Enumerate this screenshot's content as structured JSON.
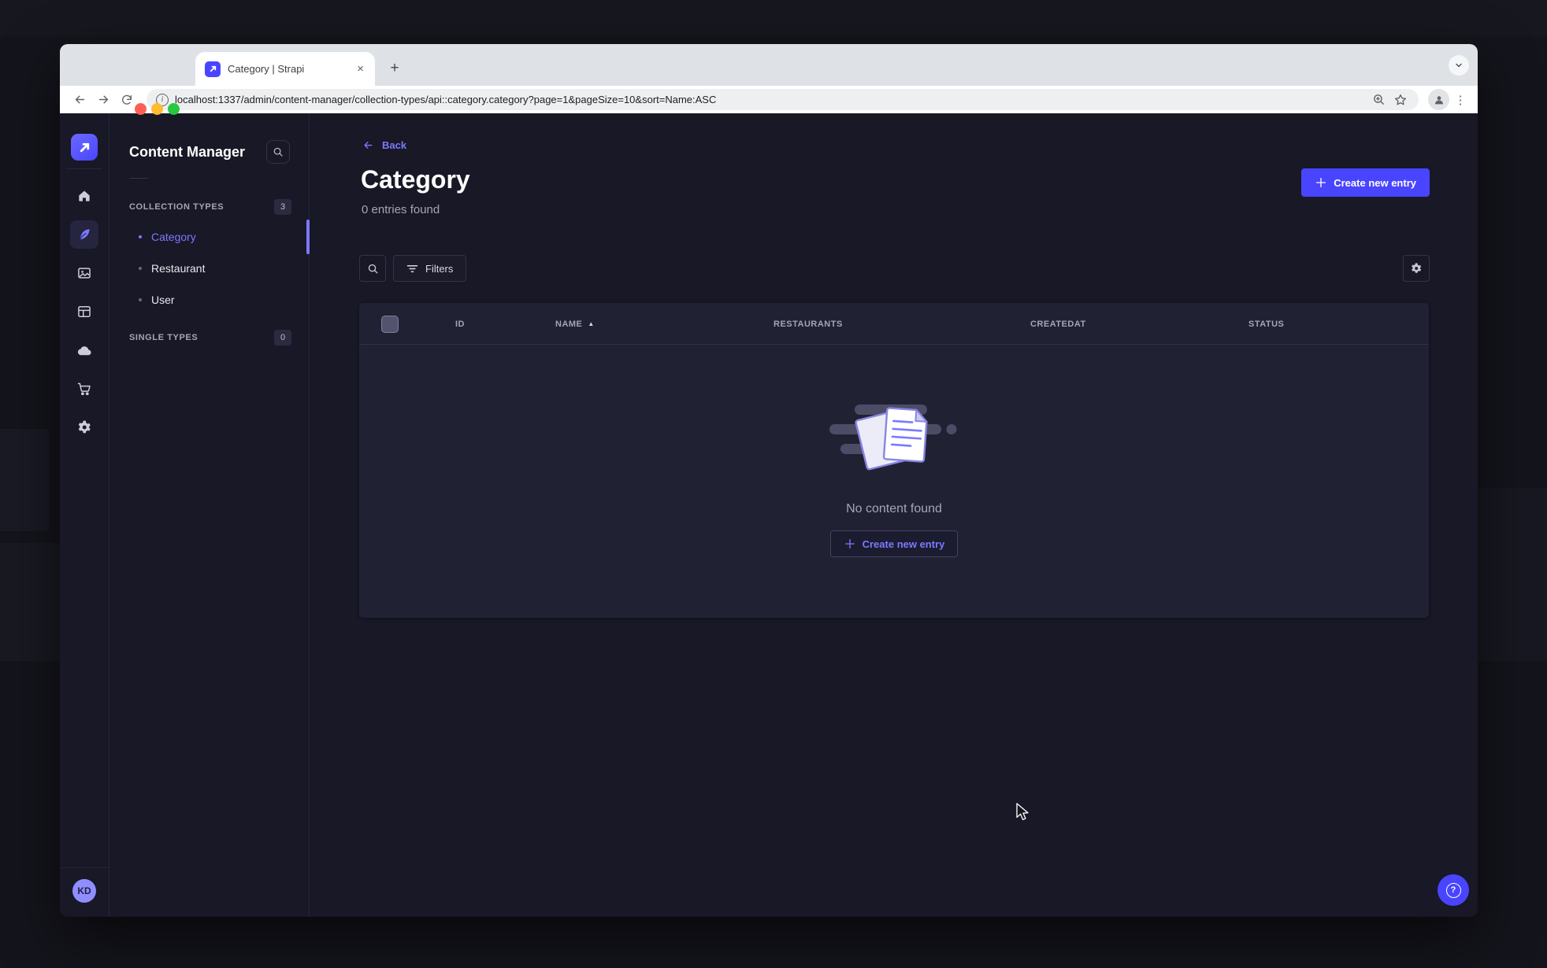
{
  "browser": {
    "tab_title": "Category | Strapi",
    "url": "localhost:1337/admin/content-manager/collection-types/api::category.category?page=1&pageSize=10&sort=Name:ASC"
  },
  "icons": {
    "close": "×",
    "plus": "+",
    "help": "?",
    "kebab": "⋮",
    "bullet": "•",
    "sort_asc": "▲",
    "info": "i"
  },
  "avatar": {
    "initials": "KD"
  },
  "subnav": {
    "title": "Content Manager",
    "sections": [
      {
        "label": "COLLECTION TYPES",
        "count": "3",
        "items": [
          {
            "label": "Category",
            "active": true
          },
          {
            "label": "Restaurant",
            "active": false
          },
          {
            "label": "User",
            "active": false
          }
        ]
      },
      {
        "label": "SINGLE TYPES",
        "count": "0",
        "items": []
      }
    ]
  },
  "main": {
    "back_label": "Back",
    "title": "Category",
    "subtitle": "0 entries found",
    "create_button_label": "Create new entry",
    "filters_button_label": "Filters",
    "table": {
      "columns": [
        "ID",
        "NAME",
        "RESTAURANTS",
        "CREATEDAT",
        "STATUS"
      ],
      "sorted_column": "NAME",
      "sort_direction": "ASC",
      "rows": []
    },
    "empty_state": {
      "message": "No content found",
      "cta_label": "Create new entry"
    }
  },
  "colors": {
    "primary": "#4945ff",
    "primary_light": "#7b79ff",
    "page_bg": "#181826",
    "card_bg": "#212134"
  }
}
